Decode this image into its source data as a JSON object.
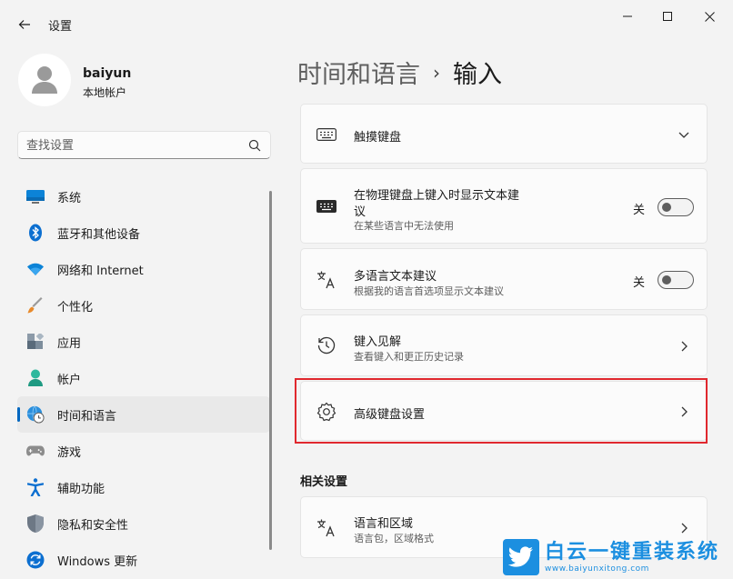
{
  "window": {
    "title": "设置"
  },
  "profile": {
    "name": "baiyun",
    "account_type": "本地帐户"
  },
  "search": {
    "placeholder": "查找设置"
  },
  "nav": {
    "items": [
      {
        "label": "系统",
        "icon": "monitor-icon"
      },
      {
        "label": "蓝牙和其他设备",
        "icon": "bluetooth-icon"
      },
      {
        "label": "网络和 Internet",
        "icon": "wifi-icon"
      },
      {
        "label": "个性化",
        "icon": "brush-icon"
      },
      {
        "label": "应用",
        "icon": "apps-icon"
      },
      {
        "label": "帐户",
        "icon": "person-icon"
      },
      {
        "label": "时间和语言",
        "icon": "globe-clock-icon",
        "active": true
      },
      {
        "label": "游戏",
        "icon": "gamepad-icon"
      },
      {
        "label": "辅助功能",
        "icon": "accessibility-icon"
      },
      {
        "label": "隐私和安全性",
        "icon": "shield-icon"
      },
      {
        "label": "Windows 更新",
        "icon": "update-icon"
      }
    ]
  },
  "breadcrumb": {
    "parent": "时间和语言",
    "separator": "›",
    "current": "输入"
  },
  "cards": {
    "touch_keyboard": {
      "title": "触摸键盘",
      "icon": "keyboard-icon"
    },
    "physical_suggestions": {
      "title_line1": "在物理键盘上键入时显示文本建",
      "title_line2": "议",
      "subtitle": "在某些语言中无法使用",
      "toggle_label": "关",
      "toggle_on": false,
      "icon": "keyboard-icon"
    },
    "multilingual": {
      "title": "多语言文本建议",
      "subtitle": "根据我的语言首选项显示文本建议",
      "toggle_label": "关",
      "toggle_on": false,
      "icon": "language-icon"
    },
    "typing_insights": {
      "title": "键入见解",
      "subtitle": "查看键入和更正历史记录",
      "icon": "history-icon"
    },
    "advanced_keyboard": {
      "title": "高级键盘设置",
      "icon": "gear-icon"
    }
  },
  "related": {
    "header": "相关设置",
    "language_region": {
      "title": "语言和区域",
      "subtitle": "语言包，区域格式",
      "icon": "language-icon"
    }
  },
  "watermark": {
    "text": "白云一键重装系统",
    "url": "www.baiyunxitong.com"
  },
  "colors": {
    "accent": "#0067c0",
    "highlight": "#e0282e",
    "watermark": "#1c8fe0"
  }
}
